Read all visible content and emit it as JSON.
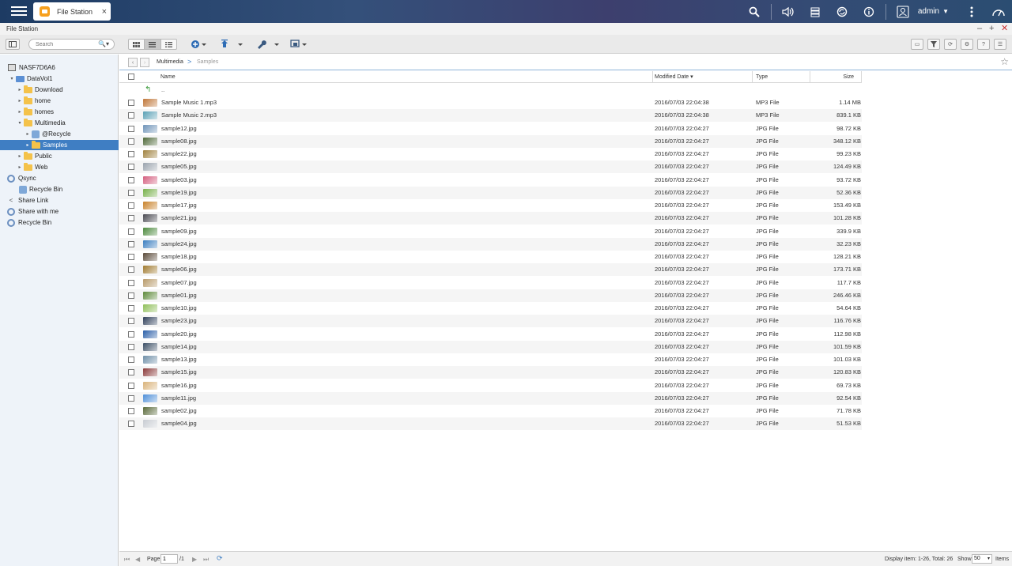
{
  "topbar": {
    "app_tab_label": "File Station",
    "tab_close": "×",
    "user": "admin",
    "icons": [
      "search-icon",
      "volume-icon",
      "stack-icon",
      "sync-icon",
      "info-icon",
      "user-icon",
      "more-icon",
      "dashboard-icon"
    ]
  },
  "window": {
    "title": "File Station",
    "minimize": "–",
    "maximize": "+",
    "close": "✕"
  },
  "toolbar": {
    "search_placeholder": "Search"
  },
  "sidebar": {
    "items": [
      {
        "label": "NASF7D6A6",
        "icon": "nas-icon",
        "arrow": ""
      },
      {
        "label": "DataVol1",
        "icon": "volume-icon",
        "arrow": "▾"
      },
      {
        "label": "Download",
        "icon": "folder-icon",
        "arrow": "▸"
      },
      {
        "label": "home",
        "icon": "folder-icon",
        "arrow": "▸"
      },
      {
        "label": "homes",
        "icon": "folder-icon",
        "arrow": "▸"
      },
      {
        "label": "Multimedia",
        "icon": "folder-icon",
        "arrow": "▾"
      },
      {
        "label": "@Recycle",
        "icon": "recycle-icon",
        "arrow": "▸"
      },
      {
        "label": "Samples",
        "icon": "folder-icon",
        "arrow": "▸"
      },
      {
        "label": "Public",
        "icon": "folder-icon",
        "arrow": "▸"
      },
      {
        "label": "Web",
        "icon": "folder-icon",
        "arrow": "▸"
      },
      {
        "label": "Qsync",
        "icon": "qsync-icon",
        "arrow": ""
      },
      {
        "label": "Recycle Bin",
        "icon": "recycle-icon",
        "arrow": ""
      },
      {
        "label": "Share Link",
        "icon": "share-link-icon",
        "arrow": ""
      },
      {
        "label": "Share with me",
        "icon": "share-with-me-icon",
        "arrow": ""
      },
      {
        "label": "Recycle Bin",
        "icon": "recycle-bin-icon",
        "arrow": ""
      }
    ]
  },
  "breadcrumb": {
    "parent": "Multimedia",
    "separator": ">",
    "current": "Samples"
  },
  "table": {
    "columns": {
      "name": "Name",
      "modified": "Modified Date",
      "type": "Type",
      "size": "Size"
    },
    "sort_indicator": "▾",
    "parent_label": "..",
    "rows": [
      {
        "name": "Sample Music 1.mp3",
        "date": "2016/07/03 22:04:38",
        "type": "MP3 File",
        "size": "1.14 MB",
        "color": "#c0773a"
      },
      {
        "name": "Sample Music 2.mp3",
        "date": "2016/07/03 22:04:38",
        "type": "MP3 File",
        "size": "839.1 KB",
        "color": "#5aa0b5"
      },
      {
        "name": "sample12.jpg",
        "date": "2016/07/03 22:04:27",
        "type": "JPG File",
        "size": "98.72 KB",
        "color": "#6f93b8"
      },
      {
        "name": "sample08.jpg",
        "date": "2016/07/03 22:04:27",
        "type": "JPG File",
        "size": "348.12 KB",
        "color": "#4f6a3a"
      },
      {
        "name": "sample22.jpg",
        "date": "2016/07/03 22:04:27",
        "type": "JPG File",
        "size": "99.23 KB",
        "color": "#a0823f"
      },
      {
        "name": "sample05.jpg",
        "date": "2016/07/03 22:04:27",
        "type": "JPG File",
        "size": "124.49 KB",
        "color": "#9aa3ad"
      },
      {
        "name": "sample03.jpg",
        "date": "2016/07/03 22:04:27",
        "type": "JPG File",
        "size": "93.72 KB",
        "color": "#d45f7f"
      },
      {
        "name": "sample19.jpg",
        "date": "2016/07/03 22:04:27",
        "type": "JPG File",
        "size": "52.36 KB",
        "color": "#77b04a"
      },
      {
        "name": "sample17.jpg",
        "date": "2016/07/03 22:04:27",
        "type": "JPG File",
        "size": "153.49 KB",
        "color": "#c9822a"
      },
      {
        "name": "sample21.jpg",
        "date": "2016/07/03 22:04:27",
        "type": "JPG File",
        "size": "101.28 KB",
        "color": "#4a4a52"
      },
      {
        "name": "sample09.jpg",
        "date": "2016/07/03 22:04:27",
        "type": "JPG File",
        "size": "339.9 KB",
        "color": "#4d8a3e"
      },
      {
        "name": "sample24.jpg",
        "date": "2016/07/03 22:04:27",
        "type": "JPG File",
        "size": "32.23 KB",
        "color": "#3b7ec0"
      },
      {
        "name": "sample18.jpg",
        "date": "2016/07/03 22:04:27",
        "type": "JPG File",
        "size": "128.21 KB",
        "color": "#5a4a3a"
      },
      {
        "name": "sample06.jpg",
        "date": "2016/07/03 22:04:27",
        "type": "JPG File",
        "size": "173.71 KB",
        "color": "#a07a2f"
      },
      {
        "name": "sample07.jpg",
        "date": "2016/07/03 22:04:27",
        "type": "JPG File",
        "size": "117.7 KB",
        "color": "#b89a6a"
      },
      {
        "name": "sample01.jpg",
        "date": "2016/07/03 22:04:27",
        "type": "JPG File",
        "size": "246.46 KB",
        "color": "#5e8a3a"
      },
      {
        "name": "sample10.jpg",
        "date": "2016/07/03 22:04:27",
        "type": "JPG File",
        "size": "54.64 KB",
        "color": "#8fbf5a"
      },
      {
        "name": "sample23.jpg",
        "date": "2016/07/03 22:04:27",
        "type": "JPG File",
        "size": "116.76 KB",
        "color": "#2f3f5a"
      },
      {
        "name": "sample20.jpg",
        "date": "2016/07/03 22:04:27",
        "type": "JPG File",
        "size": "112.98 KB",
        "color": "#2b5fa8"
      },
      {
        "name": "sample14.jpg",
        "date": "2016/07/03 22:04:27",
        "type": "JPG File",
        "size": "101.59 KB",
        "color": "#3c4f66"
      },
      {
        "name": "sample13.jpg",
        "date": "2016/07/03 22:04:27",
        "type": "JPG File",
        "size": "101.03 KB",
        "color": "#6f8fa8"
      },
      {
        "name": "sample15.jpg",
        "date": "2016/07/03 22:04:27",
        "type": "JPG File",
        "size": "120.83 KB",
        "color": "#8a3a3a"
      },
      {
        "name": "sample16.jpg",
        "date": "2016/07/03 22:04:27",
        "type": "JPG File",
        "size": "69.73 KB",
        "color": "#d9b37a"
      },
      {
        "name": "sample11.jpg",
        "date": "2016/07/03 22:04:27",
        "type": "JPG File",
        "size": "92.54 KB",
        "color": "#4f8fd8"
      },
      {
        "name": "sample02.jpg",
        "date": "2016/07/03 22:04:27",
        "type": "JPG File",
        "size": "71.78 KB",
        "color": "#5a6a3a"
      },
      {
        "name": "sample04.jpg",
        "date": "2016/07/03 22:04:27",
        "type": "JPG File",
        "size": "51.53 KB",
        "color": "#c8ccd2"
      }
    ]
  },
  "statusbar": {
    "page_label": "Page",
    "page_value": "1",
    "page_total": "/1",
    "display_info": "Display item: 1-26, Total: 26",
    "show_label": "Show",
    "show_value": "50",
    "items_label": "Items"
  }
}
